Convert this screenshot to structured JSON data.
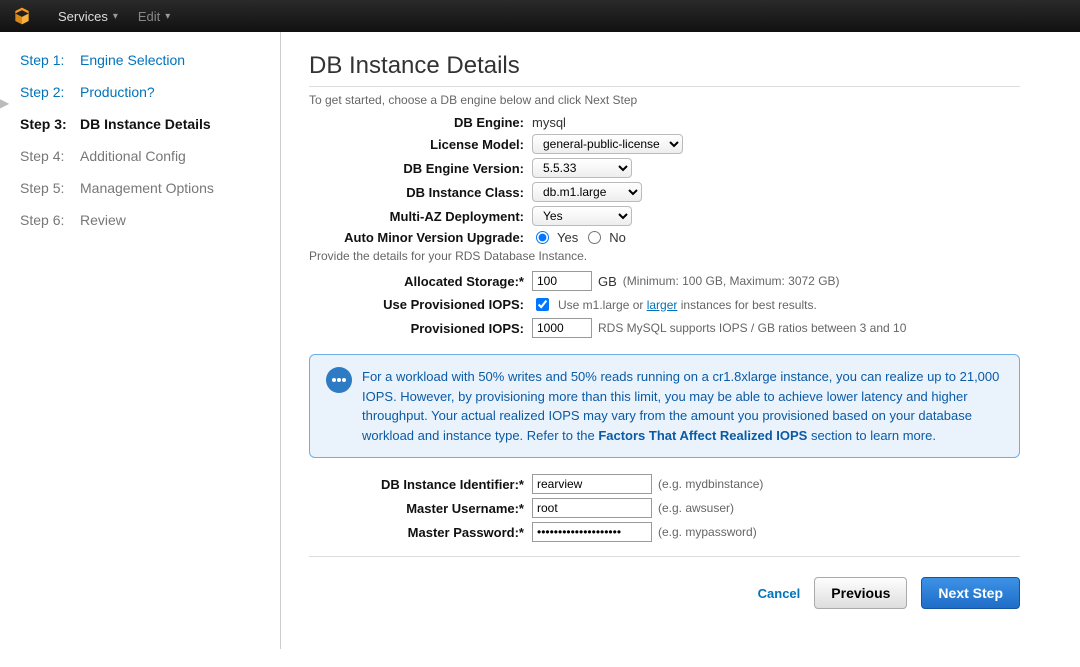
{
  "topbar": {
    "services": "Services",
    "edit": "Edit"
  },
  "steps": [
    {
      "n": "Step 1:",
      "t": "Engine Selection",
      "state": "done"
    },
    {
      "n": "Step 2:",
      "t": "Production?",
      "state": "done"
    },
    {
      "n": "Step 3:",
      "t": "DB Instance Details",
      "state": "active"
    },
    {
      "n": "Step 4:",
      "t": "Additional Config",
      "state": "pending"
    },
    {
      "n": "Step 5:",
      "t": "Management Options",
      "state": "pending"
    },
    {
      "n": "Step 6:",
      "t": "Review",
      "state": "pending"
    }
  ],
  "title": "DB Instance Details",
  "subtitle": "To get started, choose a DB engine below and click Next Step",
  "labels": {
    "engine": "DB Engine:",
    "license": "License Model:",
    "version": "DB Engine Version:",
    "class": "DB Instance Class:",
    "multiaz": "Multi-AZ Deployment:",
    "autominor": "Auto Minor Version Upgrade:",
    "storage": "Allocated Storage:*",
    "useiops": "Use Provisioned IOPS:",
    "iops": "Provisioned IOPS:",
    "identifier": "DB Instance Identifier:*",
    "username": "Master Username:*",
    "password": "Master Password:*"
  },
  "values": {
    "engine": "mysql",
    "license": "general-public-license",
    "version": "5.5.33",
    "class": "db.m1.large",
    "multiaz": "Yes",
    "yes": "Yes",
    "no": "No",
    "storage": "100",
    "gb": "GB",
    "iops": "1000",
    "identifier": "rearview",
    "username": "root",
    "password": "••••••••••••••••••••"
  },
  "hints": {
    "storage": "(Minimum: 100 GB, Maximum: 3072 GB)",
    "useiops_pre": "Use m1.large or ",
    "useiops_link": "larger",
    "useiops_post": " instances for best results.",
    "iops": "RDS MySQL supports IOPS / GB ratios between 3 and 10",
    "identifier": "(e.g. mydbinstance)",
    "username": "(e.g. awsuser)",
    "password": "(e.g. mypassword)"
  },
  "midtext": "Provide the details for your RDS Database Instance.",
  "info_text": "For a workload with 50% writes and 50% reads running on a cr1.8xlarge instance, you can realize up to 21,000 IOPS. However, by provisioning more than this limit, you may be able to achieve lower latency and higher throughput. Your actual realized IOPS may vary from the amount you provisioned based on your database workload and instance type. Refer to the ",
  "info_link": "Factors That Affect Realized IOPS",
  "info_post": " section to learn more.",
  "footer": {
    "cancel": "Cancel",
    "previous": "Previous",
    "next": "Next Step"
  }
}
